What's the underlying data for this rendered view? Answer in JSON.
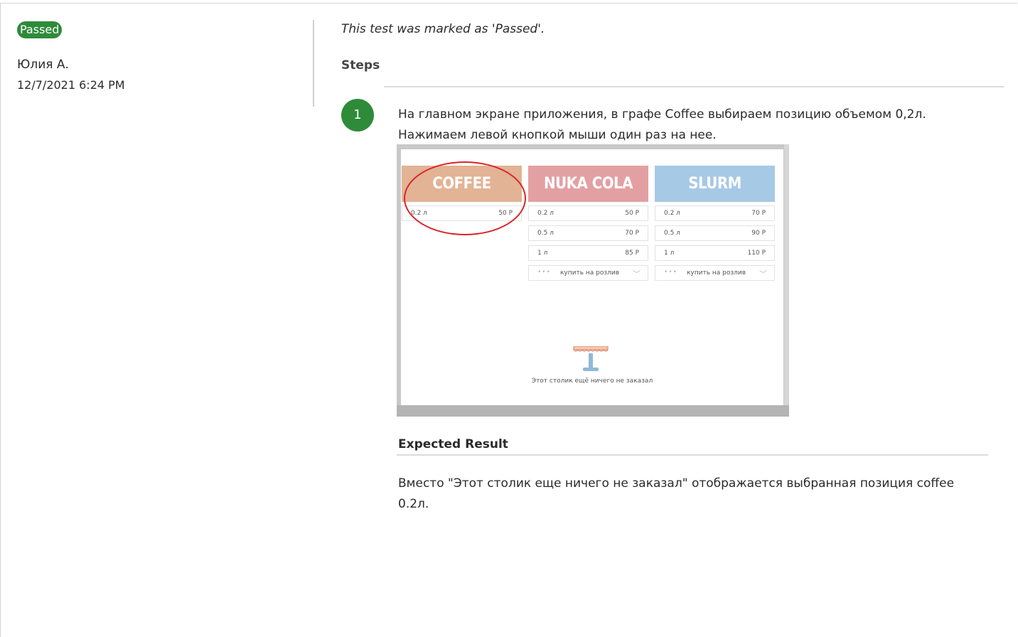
{
  "status": {
    "label": "Passed",
    "color": "#2e8b3a"
  },
  "author": "Юлия А.",
  "date": "12/7/2021 6:24 PM",
  "result_note": "This test was marked as 'Passed'.",
  "steps": {
    "heading": "Steps",
    "items": [
      {
        "number": "1",
        "text": "На главном экране приложения, в графе Coffee выбираем позицию объемом 0,2л. Нажимаем левой кнопкой мыши один раз на нее.",
        "screenshot": {
          "cards": [
            {
              "title": "COFFEE",
              "color": "#e2b394",
              "rows": [
                {
                  "size": "0.2 л",
                  "price": "50 Р"
                }
              ]
            },
            {
              "title": "NUKA COLA",
              "color": "#e3a0a3",
              "rows": [
                {
                  "size": "0.2 л",
                  "price": "50 Р"
                },
                {
                  "size": "0.5 л",
                  "price": "70 Р"
                },
                {
                  "size": "1 л",
                  "price": "85 Р"
                }
              ],
              "bulk": {
                "dots": "•••",
                "label": "купить на розлив"
              }
            },
            {
              "title": "SLURM",
              "color": "#a6c9e5",
              "rows": [
                {
                  "size": "0.2 л",
                  "price": "70 Р"
                },
                {
                  "size": "0.5 л",
                  "price": "90 Р"
                },
                {
                  "size": "1 л",
                  "price": "110 Р"
                }
              ],
              "bulk": {
                "dots": "•••",
                "label": "купить на розлив"
              }
            }
          ],
          "empty_message": "Этот столик ещё ничего не заказал",
          "highlight_color": "#d9232a"
        }
      }
    ]
  },
  "expected": {
    "heading": "Expected Result",
    "text": "Вместо \"Этот столик еще ничего не заказал\" отображается выбранная позиция coffee 0.2л."
  }
}
